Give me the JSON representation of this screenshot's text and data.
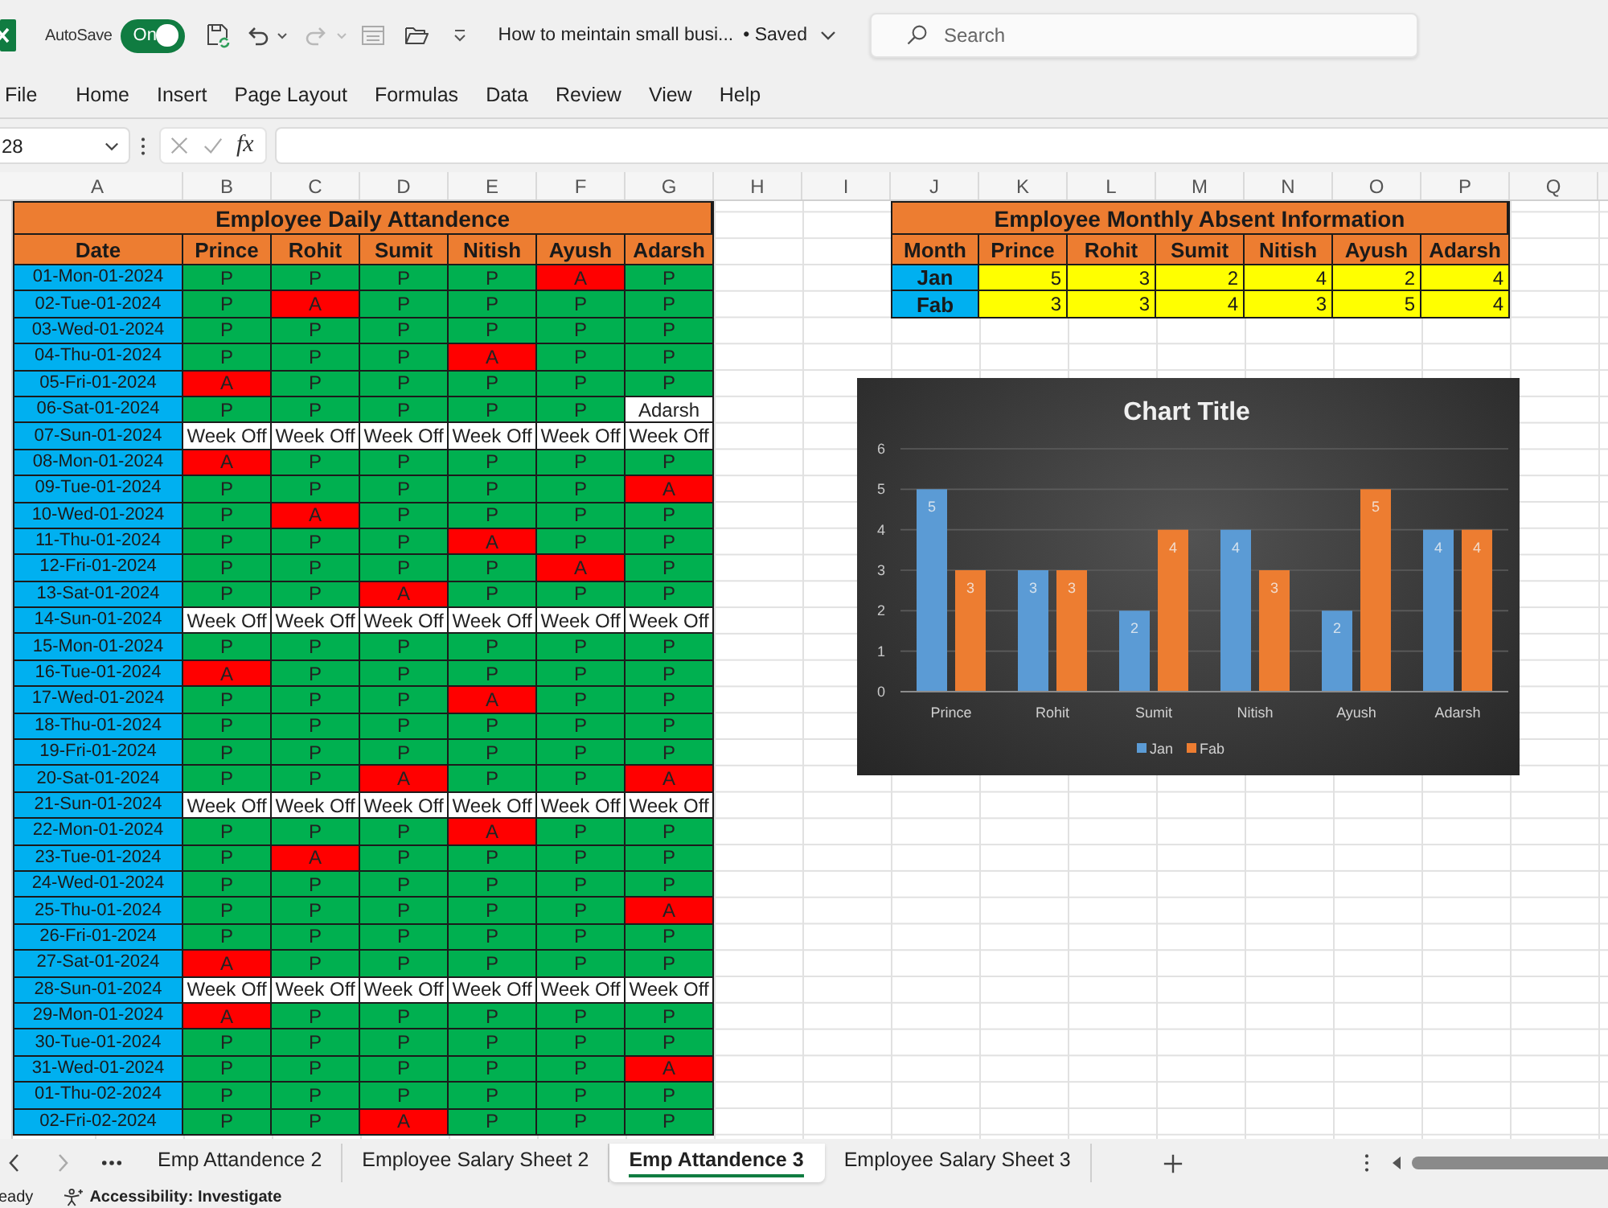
{
  "title_bar": {
    "autosave_label": "AutoSave",
    "autosave": {
      "label": "On",
      "on": true
    },
    "document_title": "How to meintain small busi...",
    "save_status": "• Saved",
    "search": {
      "placeholder": "Search"
    }
  },
  "menu": [
    "File",
    "Home",
    "Insert",
    "Page Layout",
    "Formulas",
    "Data",
    "Review",
    "View",
    "Help"
  ],
  "formula_bar": {
    "name_box": "28",
    "function_label": "fx"
  },
  "sheet": {
    "columns": [
      "A",
      "B",
      "C",
      "D",
      "E",
      "F",
      "G",
      "H",
      "I",
      "J",
      "K",
      "L",
      "M",
      "N",
      "O",
      "P",
      "Q"
    ],
    "attendance": {
      "title": "Employee Daily Attandence",
      "headers": [
        "Date",
        "Prince",
        "Rohit",
        "Sumit",
        "Nitish",
        "Ayush",
        "Adarsh"
      ],
      "rows": [
        {
          "date": "01-Mon-01-2024",
          "cells": [
            {
              "text": "P",
              "kind": "present"
            },
            {
              "text": "P",
              "kind": "present"
            },
            {
              "text": "P",
              "kind": "present"
            },
            {
              "text": "P",
              "kind": "present"
            },
            {
              "text": "A",
              "kind": "absent"
            },
            {
              "text": "P",
              "kind": "present"
            }
          ]
        },
        {
          "date": "02-Tue-01-2024",
          "cells": [
            {
              "text": "P",
              "kind": "present"
            },
            {
              "text": "A",
              "kind": "absent"
            },
            {
              "text": "P",
              "kind": "present"
            },
            {
              "text": "P",
              "kind": "present"
            },
            {
              "text": "P",
              "kind": "present"
            },
            {
              "text": "P",
              "kind": "present"
            }
          ]
        },
        {
          "date": "03-Wed-01-2024",
          "cells": [
            {
              "text": "P",
              "kind": "present"
            },
            {
              "text": "P",
              "kind": "present"
            },
            {
              "text": "P",
              "kind": "present"
            },
            {
              "text": "P",
              "kind": "present"
            },
            {
              "text": "P",
              "kind": "present"
            },
            {
              "text": "P",
              "kind": "present"
            }
          ]
        },
        {
          "date": "04-Thu-01-2024",
          "cells": [
            {
              "text": "P",
              "kind": "present"
            },
            {
              "text": "P",
              "kind": "present"
            },
            {
              "text": "P",
              "kind": "present"
            },
            {
              "text": "A",
              "kind": "absent"
            },
            {
              "text": "P",
              "kind": "present"
            },
            {
              "text": "P",
              "kind": "present"
            }
          ]
        },
        {
          "date": "05-Fri-01-2024",
          "cells": [
            {
              "text": "A",
              "kind": "absent"
            },
            {
              "text": "P",
              "kind": "present"
            },
            {
              "text": "P",
              "kind": "present"
            },
            {
              "text": "P",
              "kind": "present"
            },
            {
              "text": "P",
              "kind": "present"
            },
            {
              "text": "P",
              "kind": "present"
            }
          ]
        },
        {
          "date": "06-Sat-01-2024",
          "cells": [
            {
              "text": "P",
              "kind": "present"
            },
            {
              "text": "P",
              "kind": "present"
            },
            {
              "text": "P",
              "kind": "present"
            },
            {
              "text": "P",
              "kind": "present"
            },
            {
              "text": "P",
              "kind": "present"
            },
            {
              "text": "Adarsh",
              "kind": "unfilled"
            }
          ]
        },
        {
          "date": "07-Sun-01-2024",
          "cells": [
            {
              "text": "Week Off",
              "kind": "unfilled"
            },
            {
              "text": "Week Off",
              "kind": "unfilled"
            },
            {
              "text": "Week Off",
              "kind": "unfilled"
            },
            {
              "text": "Week Off",
              "kind": "unfilled"
            },
            {
              "text": "Week Off",
              "kind": "unfilled"
            },
            {
              "text": "Week Off",
              "kind": "unfilled"
            }
          ]
        },
        {
          "date": "08-Mon-01-2024",
          "cells": [
            {
              "text": "A",
              "kind": "absent"
            },
            {
              "text": "P",
              "kind": "present"
            },
            {
              "text": "P",
              "kind": "present"
            },
            {
              "text": "P",
              "kind": "present"
            },
            {
              "text": "P",
              "kind": "present"
            },
            {
              "text": "P",
              "kind": "present"
            }
          ]
        },
        {
          "date": "09-Tue-01-2024",
          "cells": [
            {
              "text": "P",
              "kind": "present"
            },
            {
              "text": "P",
              "kind": "present"
            },
            {
              "text": "P",
              "kind": "present"
            },
            {
              "text": "P",
              "kind": "present"
            },
            {
              "text": "P",
              "kind": "present"
            },
            {
              "text": "A",
              "kind": "absent"
            }
          ]
        },
        {
          "date": "10-Wed-01-2024",
          "cells": [
            {
              "text": "P",
              "kind": "present"
            },
            {
              "text": "A",
              "kind": "absent"
            },
            {
              "text": "P",
              "kind": "present"
            },
            {
              "text": "P",
              "kind": "present"
            },
            {
              "text": "P",
              "kind": "present"
            },
            {
              "text": "P",
              "kind": "present"
            }
          ]
        },
        {
          "date": "11-Thu-01-2024",
          "cells": [
            {
              "text": "P",
              "kind": "present"
            },
            {
              "text": "P",
              "kind": "present"
            },
            {
              "text": "P",
              "kind": "present"
            },
            {
              "text": "A",
              "kind": "absent"
            },
            {
              "text": "P",
              "kind": "present"
            },
            {
              "text": "P",
              "kind": "present"
            }
          ]
        },
        {
          "date": "12-Fri-01-2024",
          "cells": [
            {
              "text": "P",
              "kind": "present"
            },
            {
              "text": "P",
              "kind": "present"
            },
            {
              "text": "P",
              "kind": "present"
            },
            {
              "text": "P",
              "kind": "present"
            },
            {
              "text": "A",
              "kind": "absent"
            },
            {
              "text": "P",
              "kind": "present"
            }
          ]
        },
        {
          "date": "13-Sat-01-2024",
          "cells": [
            {
              "text": "P",
              "kind": "present"
            },
            {
              "text": "P",
              "kind": "present"
            },
            {
              "text": "A",
              "kind": "absent"
            },
            {
              "text": "P",
              "kind": "present"
            },
            {
              "text": "P",
              "kind": "present"
            },
            {
              "text": "P",
              "kind": "present"
            }
          ]
        },
        {
          "date": "14-Sun-01-2024",
          "cells": [
            {
              "text": "Week Off",
              "kind": "unfilled"
            },
            {
              "text": "Week Off",
              "kind": "unfilled"
            },
            {
              "text": "Week Off",
              "kind": "unfilled"
            },
            {
              "text": "Week Off",
              "kind": "unfilled"
            },
            {
              "text": "Week Off",
              "kind": "unfilled"
            },
            {
              "text": "Week Off",
              "kind": "unfilled"
            }
          ]
        },
        {
          "date": "15-Mon-01-2024",
          "cells": [
            {
              "text": "P",
              "kind": "present"
            },
            {
              "text": "P",
              "kind": "present"
            },
            {
              "text": "P",
              "kind": "present"
            },
            {
              "text": "P",
              "kind": "present"
            },
            {
              "text": "P",
              "kind": "present"
            },
            {
              "text": "P",
              "kind": "present"
            }
          ]
        },
        {
          "date": "16-Tue-01-2024",
          "cells": [
            {
              "text": "A",
              "kind": "absent"
            },
            {
              "text": "P",
              "kind": "present"
            },
            {
              "text": "P",
              "kind": "present"
            },
            {
              "text": "P",
              "kind": "present"
            },
            {
              "text": "P",
              "kind": "present"
            },
            {
              "text": "P",
              "kind": "present"
            }
          ]
        },
        {
          "date": "17-Wed-01-2024",
          "cells": [
            {
              "text": "P",
              "kind": "present"
            },
            {
              "text": "P",
              "kind": "present"
            },
            {
              "text": "P",
              "kind": "present"
            },
            {
              "text": "A",
              "kind": "absent"
            },
            {
              "text": "P",
              "kind": "present"
            },
            {
              "text": "P",
              "kind": "present"
            }
          ]
        },
        {
          "date": "18-Thu-01-2024",
          "cells": [
            {
              "text": "P",
              "kind": "present"
            },
            {
              "text": "P",
              "kind": "present"
            },
            {
              "text": "P",
              "kind": "present"
            },
            {
              "text": "P",
              "kind": "present"
            },
            {
              "text": "P",
              "kind": "present"
            },
            {
              "text": "P",
              "kind": "present"
            }
          ]
        },
        {
          "date": "19-Fri-01-2024",
          "cells": [
            {
              "text": "P",
              "kind": "present"
            },
            {
              "text": "P",
              "kind": "present"
            },
            {
              "text": "P",
              "kind": "present"
            },
            {
              "text": "P",
              "kind": "present"
            },
            {
              "text": "P",
              "kind": "present"
            },
            {
              "text": "P",
              "kind": "present"
            }
          ]
        },
        {
          "date": "20-Sat-01-2024",
          "cells": [
            {
              "text": "P",
              "kind": "present"
            },
            {
              "text": "P",
              "kind": "present"
            },
            {
              "text": "A",
              "kind": "absent"
            },
            {
              "text": "P",
              "kind": "present"
            },
            {
              "text": "P",
              "kind": "present"
            },
            {
              "text": "A",
              "kind": "absent"
            }
          ]
        },
        {
          "date": "21-Sun-01-2024",
          "cells": [
            {
              "text": "Week Off",
              "kind": "unfilled"
            },
            {
              "text": "Week Off",
              "kind": "unfilled"
            },
            {
              "text": "Week Off",
              "kind": "unfilled"
            },
            {
              "text": "Week Off",
              "kind": "unfilled"
            },
            {
              "text": "Week Off",
              "kind": "unfilled"
            },
            {
              "text": "Week Off",
              "kind": "unfilled"
            }
          ]
        },
        {
          "date": "22-Mon-01-2024",
          "cells": [
            {
              "text": "P",
              "kind": "present"
            },
            {
              "text": "P",
              "kind": "present"
            },
            {
              "text": "P",
              "kind": "present"
            },
            {
              "text": "A",
              "kind": "absent"
            },
            {
              "text": "P",
              "kind": "present"
            },
            {
              "text": "P",
              "kind": "present"
            }
          ]
        },
        {
          "date": "23-Tue-01-2024",
          "cells": [
            {
              "text": "P",
              "kind": "present"
            },
            {
              "text": "A",
              "kind": "absent"
            },
            {
              "text": "P",
              "kind": "present"
            },
            {
              "text": "P",
              "kind": "present"
            },
            {
              "text": "P",
              "kind": "present"
            },
            {
              "text": "P",
              "kind": "present"
            }
          ]
        },
        {
          "date": "24-Wed-01-2024",
          "cells": [
            {
              "text": "P",
              "kind": "present"
            },
            {
              "text": "P",
              "kind": "present"
            },
            {
              "text": "P",
              "kind": "present"
            },
            {
              "text": "P",
              "kind": "present"
            },
            {
              "text": "P",
              "kind": "present"
            },
            {
              "text": "P",
              "kind": "present"
            }
          ]
        },
        {
          "date": "25-Thu-01-2024",
          "cells": [
            {
              "text": "P",
              "kind": "present"
            },
            {
              "text": "P",
              "kind": "present"
            },
            {
              "text": "P",
              "kind": "present"
            },
            {
              "text": "P",
              "kind": "present"
            },
            {
              "text": "P",
              "kind": "present"
            },
            {
              "text": "A",
              "kind": "absent"
            }
          ]
        },
        {
          "date": "26-Fri-01-2024",
          "cells": [
            {
              "text": "P",
              "kind": "present"
            },
            {
              "text": "P",
              "kind": "present"
            },
            {
              "text": "P",
              "kind": "present"
            },
            {
              "text": "P",
              "kind": "present"
            },
            {
              "text": "P",
              "kind": "present"
            },
            {
              "text": "P",
              "kind": "present"
            }
          ]
        },
        {
          "date": "27-Sat-01-2024",
          "cells": [
            {
              "text": "A",
              "kind": "absent"
            },
            {
              "text": "P",
              "kind": "present"
            },
            {
              "text": "P",
              "kind": "present"
            },
            {
              "text": "P",
              "kind": "present"
            },
            {
              "text": "P",
              "kind": "present"
            },
            {
              "text": "P",
              "kind": "present"
            }
          ]
        },
        {
          "date": "28-Sun-01-2024",
          "cells": [
            {
              "text": "Week Off",
              "kind": "unfilled"
            },
            {
              "text": "Week Off",
              "kind": "unfilled"
            },
            {
              "text": "Week Off",
              "kind": "unfilled"
            },
            {
              "text": "Week Off",
              "kind": "unfilled"
            },
            {
              "text": "Week Off",
              "kind": "unfilled"
            },
            {
              "text": "Week Off",
              "kind": "unfilled"
            }
          ]
        },
        {
          "date": "29-Mon-01-2024",
          "cells": [
            {
              "text": "A",
              "kind": "absent"
            },
            {
              "text": "P",
              "kind": "present"
            },
            {
              "text": "P",
              "kind": "present"
            },
            {
              "text": "P",
              "kind": "present"
            },
            {
              "text": "P",
              "kind": "present"
            },
            {
              "text": "P",
              "kind": "present"
            }
          ]
        },
        {
          "date": "30-Tue-01-2024",
          "cells": [
            {
              "text": "P",
              "kind": "present"
            },
            {
              "text": "P",
              "kind": "present"
            },
            {
              "text": "P",
              "kind": "present"
            },
            {
              "text": "P",
              "kind": "present"
            },
            {
              "text": "P",
              "kind": "present"
            },
            {
              "text": "P",
              "kind": "present"
            }
          ]
        },
        {
          "date": "31-Wed-01-2024",
          "cells": [
            {
              "text": "P",
              "kind": "present"
            },
            {
              "text": "P",
              "kind": "present"
            },
            {
              "text": "P",
              "kind": "present"
            },
            {
              "text": "P",
              "kind": "present"
            },
            {
              "text": "P",
              "kind": "present"
            },
            {
              "text": "A",
              "kind": "absent"
            }
          ]
        },
        {
          "date": "01-Thu-02-2024",
          "cells": [
            {
              "text": "P",
              "kind": "present"
            },
            {
              "text": "P",
              "kind": "present"
            },
            {
              "text": "P",
              "kind": "present"
            },
            {
              "text": "P",
              "kind": "present"
            },
            {
              "text": "P",
              "kind": "present"
            },
            {
              "text": "P",
              "kind": "present"
            }
          ]
        },
        {
          "date": "02-Fri-02-2024",
          "cells": [
            {
              "text": "P",
              "kind": "present"
            },
            {
              "text": "P",
              "kind": "present"
            },
            {
              "text": "A",
              "kind": "absent"
            },
            {
              "text": "P",
              "kind": "present"
            },
            {
              "text": "P",
              "kind": "present"
            },
            {
              "text": "P",
              "kind": "present"
            }
          ]
        }
      ]
    },
    "absent_summary": {
      "title": "Employee Monthly Absent Information",
      "headers": [
        "Month",
        "Prince",
        "Rohit",
        "Sumit",
        "Nitish",
        "Ayush",
        "Adarsh"
      ],
      "rows": [
        {
          "month": "Jan",
          "values": [
            "5",
            "3",
            "2",
            "4",
            "2",
            "4"
          ]
        },
        {
          "month": "Fab",
          "values": [
            "3",
            "3",
            "4",
            "3",
            "5",
            "4"
          ]
        }
      ]
    },
    "chart": {
      "chart_data": {
        "type": "bar",
        "title": "Chart Title",
        "categories": [
          "Prince",
          "Rohit",
          "Sumit",
          "Nitish",
          "Ayush",
          "Adarsh"
        ],
        "series": [
          {
            "name": "Jan",
            "color": "#5b9bd5",
            "values": [
              5,
              3,
              2,
              4,
              2,
              4
            ]
          },
          {
            "name": "Fab",
            "color": "#ed7d31",
            "values": [
              3,
              3,
              4,
              3,
              5,
              4
            ]
          }
        ],
        "ylim": [
          0,
          6
        ],
        "yticks": [
          {
            "value": 0,
            "label": "0"
          },
          {
            "value": 1,
            "label": "1"
          },
          {
            "value": 2,
            "label": "2"
          },
          {
            "value": 3,
            "label": "3"
          },
          {
            "value": 4,
            "label": "4"
          },
          {
            "value": 5,
            "label": "5"
          },
          {
            "value": 6,
            "label": "6"
          }
        ],
        "grid": true,
        "legend": "bottom",
        "value_labels": [
          [
            "5",
            "3",
            "2",
            "4",
            "2",
            "4"
          ],
          [
            "3",
            "3",
            "4",
            "3",
            "5",
            "4"
          ]
        ]
      }
    }
  },
  "sheet_tabs": {
    "tabs": [
      {
        "label": "Emp Attandence 2",
        "selected": false
      },
      {
        "label": "Employee Salary Sheet 2",
        "selected": false
      },
      {
        "label": "Emp Attandence 3",
        "selected": true
      },
      {
        "label": "Employee Salary Sheet 3",
        "selected": false
      }
    ]
  },
  "status_bar": {
    "mode": "eady",
    "accessibility": "Accessibility: Investigate"
  }
}
